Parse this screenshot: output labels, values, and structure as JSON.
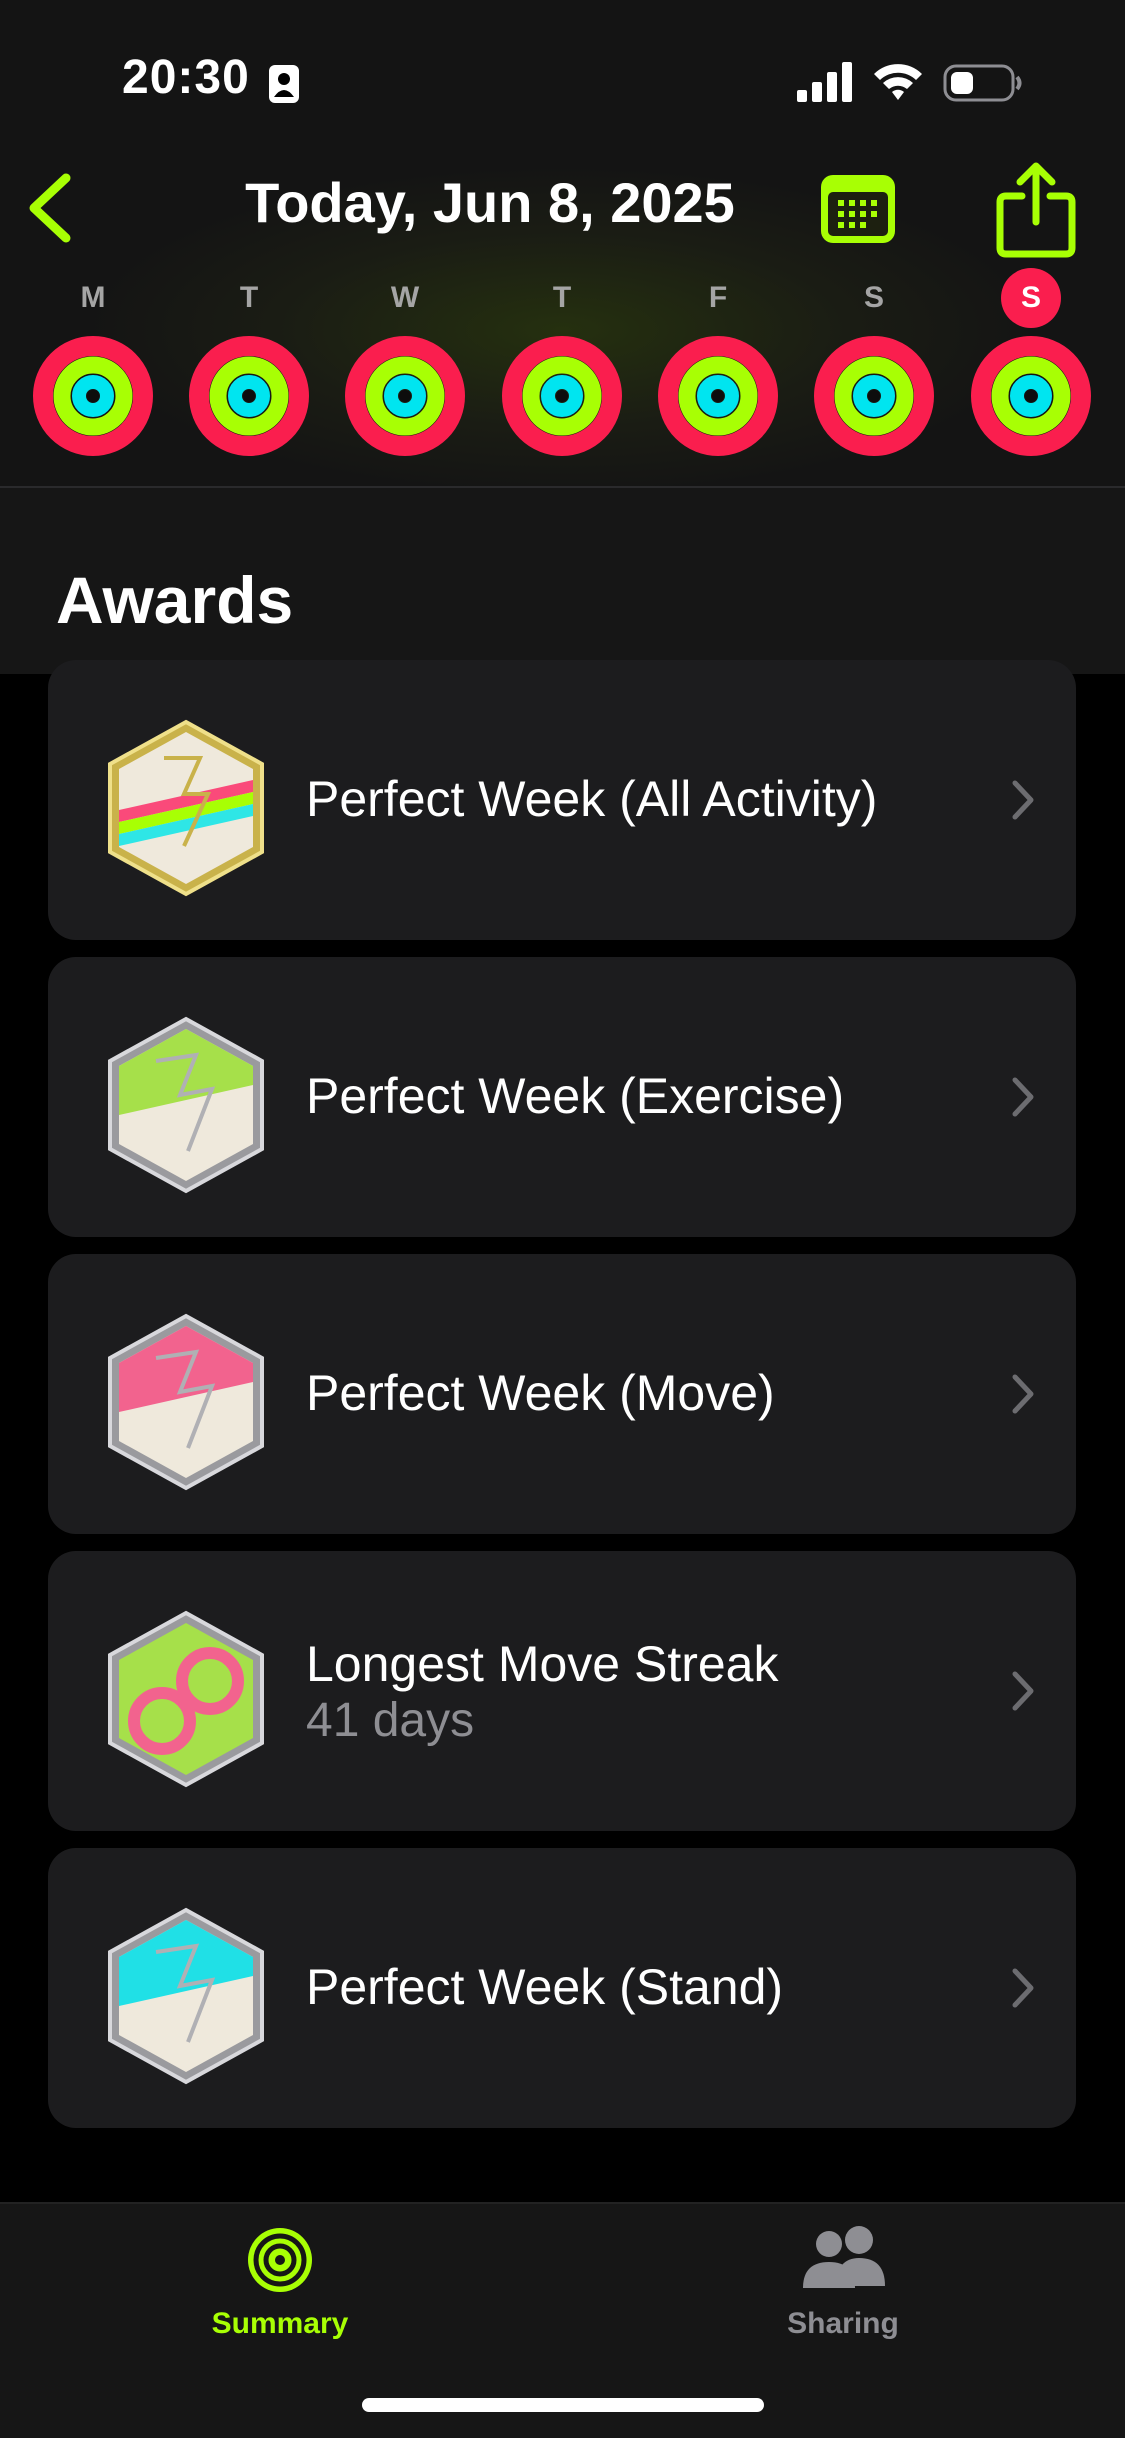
{
  "status_bar": {
    "time": "20:30",
    "icons": [
      "person-id-icon",
      "signal-icon",
      "wifi-icon",
      "battery-icon"
    ]
  },
  "nav": {
    "title": "Today, Jun 8, 2025",
    "back_icon": "chevron-left-icon",
    "calendar_icon": "calendar-icon",
    "share_icon": "share-icon"
  },
  "week": {
    "days": [
      {
        "label": "M",
        "today": false
      },
      {
        "label": "T",
        "today": false
      },
      {
        "label": "W",
        "today": false
      },
      {
        "label": "T",
        "today": false
      },
      {
        "label": "F",
        "today": false
      },
      {
        "label": "S",
        "today": false
      },
      {
        "label": "S",
        "today": true
      }
    ],
    "ring_colors": {
      "move": "#fa1e4e",
      "exercise": "#a8ff04",
      "stand": "#00e5f0"
    }
  },
  "awards": {
    "heading": "Awards",
    "items": [
      {
        "name": "Perfect Week (All Activity)",
        "subtitle": "",
        "badge": "all-activity"
      },
      {
        "name": "Perfect Week (Exercise)",
        "subtitle": "",
        "badge": "exercise"
      },
      {
        "name": "Perfect Week (Move)",
        "subtitle": "",
        "badge": "move"
      },
      {
        "name": "Longest Move Streak",
        "subtitle": "41 days",
        "badge": "streak"
      },
      {
        "name": "Perfect Week (Stand)",
        "subtitle": "",
        "badge": "stand"
      }
    ]
  },
  "tabbar": {
    "tabs": [
      {
        "label": "Summary",
        "icon": "activity-rings-icon",
        "active": true
      },
      {
        "label": "Sharing",
        "icon": "people-icon",
        "active": false
      }
    ],
    "accent": "#a8ff04",
    "inactive": "#8e8e93"
  }
}
